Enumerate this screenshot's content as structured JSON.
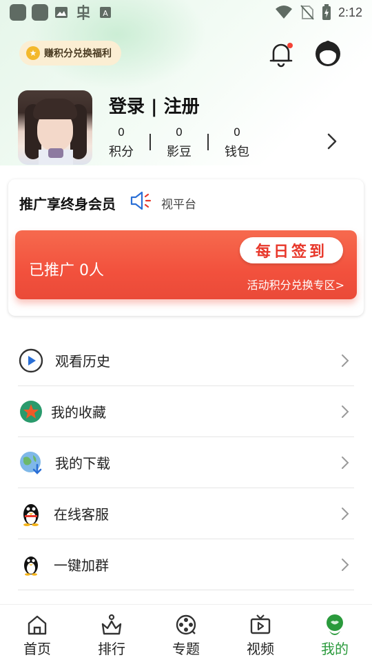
{
  "status_bar": {
    "time": "2:12",
    "left_icons": [
      "app-icon",
      "app-icon",
      "image-icon",
      "bug-icon",
      "font-icon"
    ],
    "right_icons": [
      "wifi-icon",
      "no-sim-icon",
      "battery-charging-icon"
    ]
  },
  "header": {
    "points_pill": "赚积分兑换福利",
    "notification_dot_color": "#f44336"
  },
  "profile": {
    "title": "登录 | 注册",
    "stats": [
      {
        "value": "0",
        "label": "积分"
      },
      {
        "value": "0",
        "label": "影豆"
      },
      {
        "value": "0",
        "label": "钱包"
      }
    ]
  },
  "promo": {
    "title": "推广享终身会员",
    "marquee": "视平台",
    "invited": "已推广 0人",
    "checkin_button": "每日签到",
    "exchange_link": "活动积分兑换专区>"
  },
  "menu": [
    {
      "label": "观看历史",
      "icon": "play-circle-icon"
    },
    {
      "label": "我的收藏",
      "icon": "star-badge-icon"
    },
    {
      "label": "我的下载",
      "icon": "globe-download-icon"
    },
    {
      "label": "在线客服",
      "icon": "penguin-icon"
    },
    {
      "label": "一键加群",
      "icon": "penguin-icon"
    }
  ],
  "bottom_nav": [
    {
      "label": "首页",
      "icon": "home-icon"
    },
    {
      "label": "排行",
      "icon": "ranking-icon"
    },
    {
      "label": "专题",
      "icon": "film-reel-icon"
    },
    {
      "label": "视频",
      "icon": "tv-icon"
    },
    {
      "label": "我的",
      "icon": "profile-icon",
      "active": true
    }
  ],
  "colors": {
    "accent_green": "#2a9a3c",
    "banner_red": "#f2513d",
    "checkin_text": "#e8372a"
  }
}
